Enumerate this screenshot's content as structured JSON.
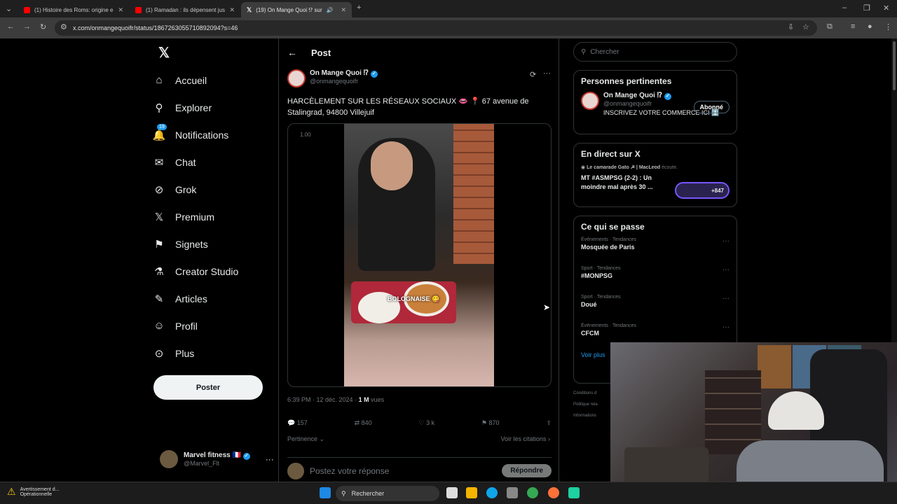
{
  "browser": {
    "tabs": [
      {
        "label": "(1) Histoire des Roms: origine e",
        "favicon_color": "#ff0000"
      },
      {
        "label": "(1) Ramadan : ils dépensent jus",
        "favicon_color": "#ff0000"
      },
      {
        "label": "(19) On Mange Quoi ⁉ sur",
        "favicon_color": "#ffffff"
      }
    ],
    "url": "x.com/onmangequoifr/status/1867263055710892094?s=46"
  },
  "nav": {
    "items": [
      {
        "label": "Accueil",
        "icon": "home-icon",
        "glyph": "⌂"
      },
      {
        "label": "Explorer",
        "icon": "search-icon",
        "glyph": "⚲"
      },
      {
        "label": "Notifications",
        "icon": "bell-icon",
        "glyph": "🔔",
        "badge": "19"
      },
      {
        "label": "Chat",
        "icon": "mail-icon",
        "glyph": "✉"
      },
      {
        "label": "Grok",
        "icon": "grok-icon",
        "glyph": "⊘"
      },
      {
        "label": "Premium",
        "icon": "x-logo-icon",
        "glyph": "𝕏"
      },
      {
        "label": "Signets",
        "icon": "bookmark-icon",
        "glyph": "⚑"
      },
      {
        "label": "Creator Studio",
        "icon": "flask-icon",
        "glyph": "⚗"
      },
      {
        "label": "Articles",
        "icon": "article-icon",
        "glyph": "✎"
      },
      {
        "label": "Profil",
        "icon": "person-icon",
        "glyph": "☺"
      },
      {
        "label": "Plus",
        "icon": "more-circle-icon",
        "glyph": "⊙"
      }
    ],
    "post_button": "Poster",
    "account_name": "Marvel fitness 🇫🇷",
    "account_handle": "@Marvel_Flt"
  },
  "post": {
    "header": "Post",
    "author_name": "On Mange Quoi ⁉",
    "author_handle": "@onmangequoifr",
    "text": "HARCÈLEMENT SUR LES RÉSEAUX SOCIAUX 👄 📍 67 avenue de Stalingrad, 94800 Villejuif",
    "video_speed": "1.00",
    "video_caption": "BOLOGNAISE 😋",
    "time": "6:39 PM · 12 déc. 2024 · ",
    "views": "1 M",
    "views_label": " vues",
    "replies": "157",
    "reposts": "840",
    "likes": "3 k",
    "bookmarks": "870",
    "sort_label": "Pertinence",
    "quotes_label": "Voir les citations",
    "reply_placeholder": "Postez votre réponse",
    "reply_button": "Répondre"
  },
  "sidebar": {
    "search_placeholder": "Chercher",
    "relevant_title": "Personnes pertinentes",
    "relevant_name": "On Mange Quoi ⁉",
    "relevant_handle": "@onmangequoifr",
    "relevant_bio": "INSCRIVEZ VOTRE COMMERCE ICI ⬇️",
    "follow_label": "Abonné",
    "live_title": "En direct sur X",
    "live_host": "Le camarade Gato ☭ | MacLeod",
    "live_host_suffix": " écoute.",
    "live_topic": "MT #ASMPSG (2-2) : Un moindre mal après 30 ...",
    "live_count": "+847",
    "trends_title": "Ce qui se passe",
    "trends": [
      {
        "category": "Événements · Tendances",
        "title": "Mosquée de Paris"
      },
      {
        "category": "Sport · Tendances",
        "title": "#MONPSG"
      },
      {
        "category": "Sport · Tendances",
        "title": "Doué"
      },
      {
        "category": "Événements · Tendances",
        "title": "CFCM"
      }
    ],
    "show_more": "Voir plus",
    "footer_lines": [
      "Conditions d",
      "Politique rela",
      "Informations"
    ]
  },
  "taskbar": {
    "notice_title": "Avertissement d...",
    "notice_status": "Opérationnelle",
    "search_label": "Rechercher"
  },
  "colors": {
    "accent": "#1d9bf0",
    "bg": "#000000",
    "border": "#2f3336"
  }
}
